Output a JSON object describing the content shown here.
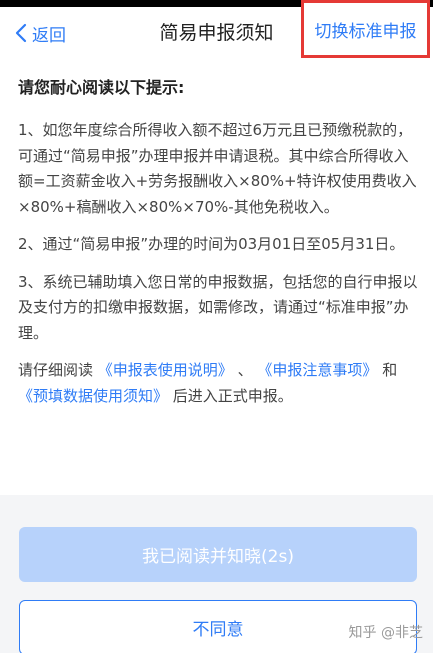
{
  "nav": {
    "back_label": "返回",
    "title": "简易申报须知",
    "switch_label": "切换标准申报"
  },
  "content": {
    "heading": "请您耐心阅读以下提示:",
    "para1": "1、如您年度综合所得收入额不超过6万元且已预缴税款的，可通过“简易申报”办理申报并申请退税。其中综合所得收入额=工资薪金收入+劳务报酬收入×80%+特许权使用费收入×80%+稿酬收入×80%×70%-其他免税收入。",
    "para2": "2、通过“简易申报”办理的时间为03月01日至05月31日。",
    "para3": "3、系统已辅助填入您日常的申报数据，包括您的自行申报以及支付方的扣缴申报数据，如需修改，请通过“标准申报”办理。",
    "notice_prefix": "请仔细阅读",
    "link1": "《申报表使用说明》",
    "sep1": "、",
    "link2": "《申报注意事项》",
    "and": "和",
    "link3": "《预填数据使用须知》",
    "notice_suffix": "后进入正式申报。"
  },
  "buttons": {
    "agree_label": "我已阅读并知晓(2s)",
    "disagree_label": "不同意"
  },
  "watermark": "知乎 @非芝",
  "colors": {
    "accent": "#2f7cf6",
    "highlight_border": "#e53935",
    "disabled_button": "#b7d2fb"
  }
}
